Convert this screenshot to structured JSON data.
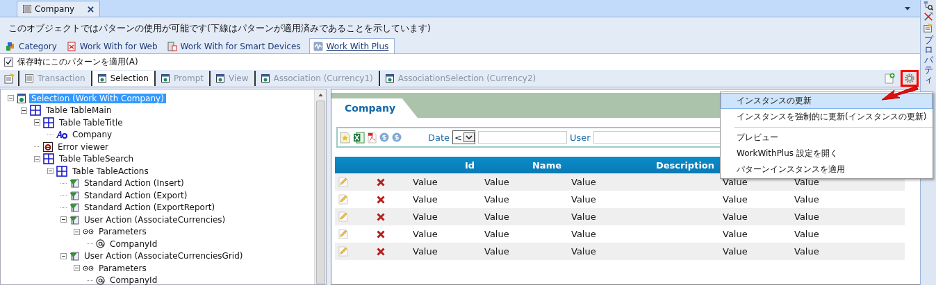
{
  "document_tab": {
    "title": "Company"
  },
  "info_text": "このオブジェクトではパターンの使用が可能です(下線はパターンが適用済みであることを示しています)",
  "pattern_tabs": [
    {
      "label": "Category",
      "kind": "category",
      "selected": false,
      "applied": false
    },
    {
      "label": "Work With for Web",
      "kind": "web",
      "selected": false,
      "applied": false
    },
    {
      "label": "Work With for Smart Devices",
      "kind": "devices",
      "selected": false,
      "applied": false
    },
    {
      "label": "Work With Plus",
      "kind": "plus",
      "selected": true,
      "applied": true
    }
  ],
  "apply_on_save": {
    "label": "保存時にこのパターンを適用(A)",
    "checked": true
  },
  "instance_tabs": [
    {
      "label": "Transaction",
      "kind": "form",
      "selected": false
    },
    {
      "label": "Selection",
      "kind": "page",
      "selected": true
    },
    {
      "label": "Prompt",
      "kind": "page",
      "selected": false
    },
    {
      "label": "View",
      "kind": "page",
      "selected": false
    },
    {
      "label": "Association (Currency1)",
      "kind": "page",
      "selected": false
    },
    {
      "label": "AssociationSelection (Currency2)",
      "kind": "page",
      "selected": false
    }
  ],
  "side_panel": {
    "label": "プロパティ"
  },
  "tree": [
    {
      "label": "Selection (Work With Company)",
      "kind": "page",
      "expanded": true,
      "selected": true,
      "children": [
        {
          "label": "Table TableMain",
          "kind": "table",
          "expanded": true,
          "selected": false,
          "children": [
            {
              "label": "Table TableTitle",
              "kind": "table",
              "expanded": true,
              "selected": false,
              "children": [
                {
                  "label": "Company",
                  "kind": "text",
                  "selected": false
                }
              ]
            },
            {
              "label": "Error viewer",
              "kind": "error",
              "selected": false
            },
            {
              "label": "Table TableSearch",
              "kind": "table",
              "expanded": true,
              "selected": false,
              "children": [
                {
                  "label": "Table TableActions",
                  "kind": "table",
                  "expanded": true,
                  "selected": false,
                  "children": [
                    {
                      "label": "Standard Action (Insert)",
                      "kind": "action",
                      "selected": false
                    },
                    {
                      "label": "Standard Action (Export)",
                      "kind": "action",
                      "selected": false
                    },
                    {
                      "label": "Standard Action (ExportReport)",
                      "kind": "action",
                      "selected": false
                    },
                    {
                      "label": "User Action (AssociateCurrencies)",
                      "kind": "action",
                      "expanded": true,
                      "selected": false,
                      "children": [
                        {
                          "label": "Parameters",
                          "kind": "params",
                          "expanded": true,
                          "selected": false,
                          "children": [
                            {
                              "label": "CompanyId",
                              "kind": "at",
                              "selected": false
                            }
                          ]
                        }
                      ]
                    },
                    {
                      "label": "User Action (AssociateCurrenciesGrid)",
                      "kind": "action",
                      "expanded": true,
                      "selected": false,
                      "children": [
                        {
                          "label": "Parameters",
                          "kind": "params",
                          "expanded": true,
                          "selected": false,
                          "children": [
                            {
                              "label": "CompanyId",
                              "kind": "at",
                              "selected": false
                            }
                          ]
                        }
                      ]
                    }
                  ]
                }
              ]
            }
          ]
        }
      ]
    }
  ],
  "preview": {
    "title": "Company",
    "search": {
      "date_label": "Date",
      "date_operator": "<",
      "user_label": "User"
    },
    "table": {
      "columns": [
        "Id",
        "Name",
        "Description"
      ],
      "rows": [
        [
          "Value",
          "Value",
          "Value",
          "Value",
          "Value"
        ],
        [
          "Value",
          "Value",
          "Value",
          "Value",
          "Value"
        ],
        [
          "Value",
          "Value",
          "Value",
          "Value",
          "Value"
        ],
        [
          "Value",
          "Value",
          "Value",
          "Value",
          "Value"
        ],
        [
          "Value",
          "Value",
          "Value",
          "Value",
          "Value"
        ]
      ]
    }
  },
  "context_menu": [
    {
      "kind": "item",
      "label": "インスタンスの更新",
      "selected": true
    },
    {
      "kind": "item",
      "label": "インスタンスを強制的に更新(インスタンスの更新)",
      "selected": false
    },
    {
      "kind": "separator"
    },
    {
      "kind": "item",
      "label": "プレビュー",
      "selected": false
    },
    {
      "kind": "item",
      "label": "WorkWithPlus 設定を開く",
      "selected": false
    },
    {
      "kind": "item",
      "label": "パターンインスタンスを適用",
      "selected": false
    }
  ]
}
